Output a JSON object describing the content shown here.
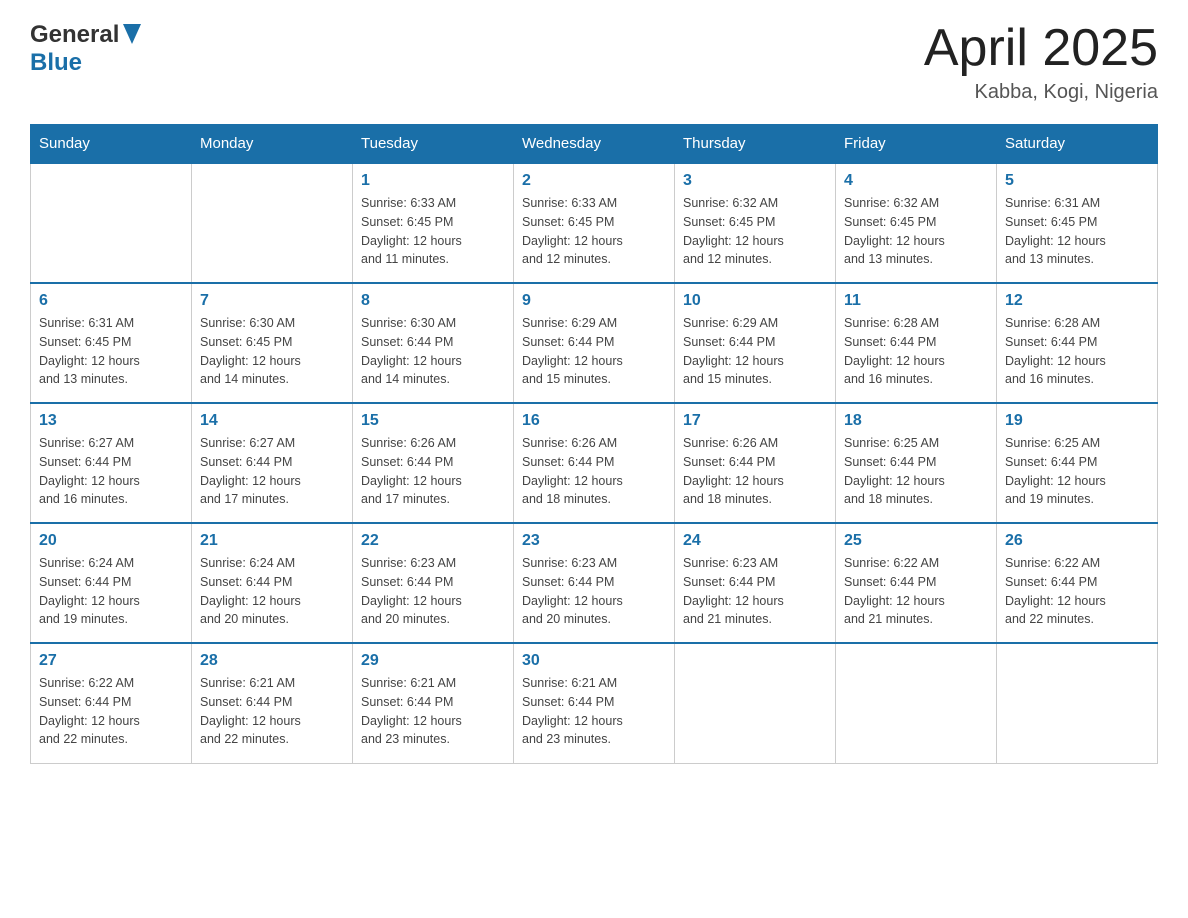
{
  "header": {
    "logo": {
      "general": "General",
      "blue": "Blue"
    },
    "title": "April 2025",
    "location": "Kabba, Kogi, Nigeria"
  },
  "calendar": {
    "days_of_week": [
      "Sunday",
      "Monday",
      "Tuesday",
      "Wednesday",
      "Thursday",
      "Friday",
      "Saturday"
    ],
    "weeks": [
      [
        {
          "day": "",
          "info": ""
        },
        {
          "day": "",
          "info": ""
        },
        {
          "day": "1",
          "info": "Sunrise: 6:33 AM\nSunset: 6:45 PM\nDaylight: 12 hours\nand 11 minutes."
        },
        {
          "day": "2",
          "info": "Sunrise: 6:33 AM\nSunset: 6:45 PM\nDaylight: 12 hours\nand 12 minutes."
        },
        {
          "day": "3",
          "info": "Sunrise: 6:32 AM\nSunset: 6:45 PM\nDaylight: 12 hours\nand 12 minutes."
        },
        {
          "day": "4",
          "info": "Sunrise: 6:32 AM\nSunset: 6:45 PM\nDaylight: 12 hours\nand 13 minutes."
        },
        {
          "day": "5",
          "info": "Sunrise: 6:31 AM\nSunset: 6:45 PM\nDaylight: 12 hours\nand 13 minutes."
        }
      ],
      [
        {
          "day": "6",
          "info": "Sunrise: 6:31 AM\nSunset: 6:45 PM\nDaylight: 12 hours\nand 13 minutes."
        },
        {
          "day": "7",
          "info": "Sunrise: 6:30 AM\nSunset: 6:45 PM\nDaylight: 12 hours\nand 14 minutes."
        },
        {
          "day": "8",
          "info": "Sunrise: 6:30 AM\nSunset: 6:44 PM\nDaylight: 12 hours\nand 14 minutes."
        },
        {
          "day": "9",
          "info": "Sunrise: 6:29 AM\nSunset: 6:44 PM\nDaylight: 12 hours\nand 15 minutes."
        },
        {
          "day": "10",
          "info": "Sunrise: 6:29 AM\nSunset: 6:44 PM\nDaylight: 12 hours\nand 15 minutes."
        },
        {
          "day": "11",
          "info": "Sunrise: 6:28 AM\nSunset: 6:44 PM\nDaylight: 12 hours\nand 16 minutes."
        },
        {
          "day": "12",
          "info": "Sunrise: 6:28 AM\nSunset: 6:44 PM\nDaylight: 12 hours\nand 16 minutes."
        }
      ],
      [
        {
          "day": "13",
          "info": "Sunrise: 6:27 AM\nSunset: 6:44 PM\nDaylight: 12 hours\nand 16 minutes."
        },
        {
          "day": "14",
          "info": "Sunrise: 6:27 AM\nSunset: 6:44 PM\nDaylight: 12 hours\nand 17 minutes."
        },
        {
          "day": "15",
          "info": "Sunrise: 6:26 AM\nSunset: 6:44 PM\nDaylight: 12 hours\nand 17 minutes."
        },
        {
          "day": "16",
          "info": "Sunrise: 6:26 AM\nSunset: 6:44 PM\nDaylight: 12 hours\nand 18 minutes."
        },
        {
          "day": "17",
          "info": "Sunrise: 6:26 AM\nSunset: 6:44 PM\nDaylight: 12 hours\nand 18 minutes."
        },
        {
          "day": "18",
          "info": "Sunrise: 6:25 AM\nSunset: 6:44 PM\nDaylight: 12 hours\nand 18 minutes."
        },
        {
          "day": "19",
          "info": "Sunrise: 6:25 AM\nSunset: 6:44 PM\nDaylight: 12 hours\nand 19 minutes."
        }
      ],
      [
        {
          "day": "20",
          "info": "Sunrise: 6:24 AM\nSunset: 6:44 PM\nDaylight: 12 hours\nand 19 minutes."
        },
        {
          "day": "21",
          "info": "Sunrise: 6:24 AM\nSunset: 6:44 PM\nDaylight: 12 hours\nand 20 minutes."
        },
        {
          "day": "22",
          "info": "Sunrise: 6:23 AM\nSunset: 6:44 PM\nDaylight: 12 hours\nand 20 minutes."
        },
        {
          "day": "23",
          "info": "Sunrise: 6:23 AM\nSunset: 6:44 PM\nDaylight: 12 hours\nand 20 minutes."
        },
        {
          "day": "24",
          "info": "Sunrise: 6:23 AM\nSunset: 6:44 PM\nDaylight: 12 hours\nand 21 minutes."
        },
        {
          "day": "25",
          "info": "Sunrise: 6:22 AM\nSunset: 6:44 PM\nDaylight: 12 hours\nand 21 minutes."
        },
        {
          "day": "26",
          "info": "Sunrise: 6:22 AM\nSunset: 6:44 PM\nDaylight: 12 hours\nand 22 minutes."
        }
      ],
      [
        {
          "day": "27",
          "info": "Sunrise: 6:22 AM\nSunset: 6:44 PM\nDaylight: 12 hours\nand 22 minutes."
        },
        {
          "day": "28",
          "info": "Sunrise: 6:21 AM\nSunset: 6:44 PM\nDaylight: 12 hours\nand 22 minutes."
        },
        {
          "day": "29",
          "info": "Sunrise: 6:21 AM\nSunset: 6:44 PM\nDaylight: 12 hours\nand 23 minutes."
        },
        {
          "day": "30",
          "info": "Sunrise: 6:21 AM\nSunset: 6:44 PM\nDaylight: 12 hours\nand 23 minutes."
        },
        {
          "day": "",
          "info": ""
        },
        {
          "day": "",
          "info": ""
        },
        {
          "day": "",
          "info": ""
        }
      ]
    ]
  }
}
